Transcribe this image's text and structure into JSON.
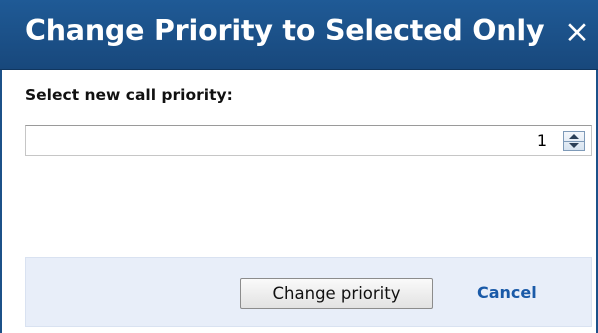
{
  "dialog": {
    "title": "Change Priority to Selected Only",
    "close_symbol": "×",
    "close_icon": "close-icon"
  },
  "form": {
    "prompt_label": "Select new call priority:",
    "priority_value": "1",
    "spinner_icons": [
      "chevron-up-icon",
      "chevron-down-icon"
    ]
  },
  "footer": {
    "change_priority_label": "Change priority",
    "cancel_label": "Cancel"
  },
  "colors": {
    "titlebar": "#1f5a96",
    "footer_bg": "#e8eef9",
    "link": "#1a5aa8"
  }
}
